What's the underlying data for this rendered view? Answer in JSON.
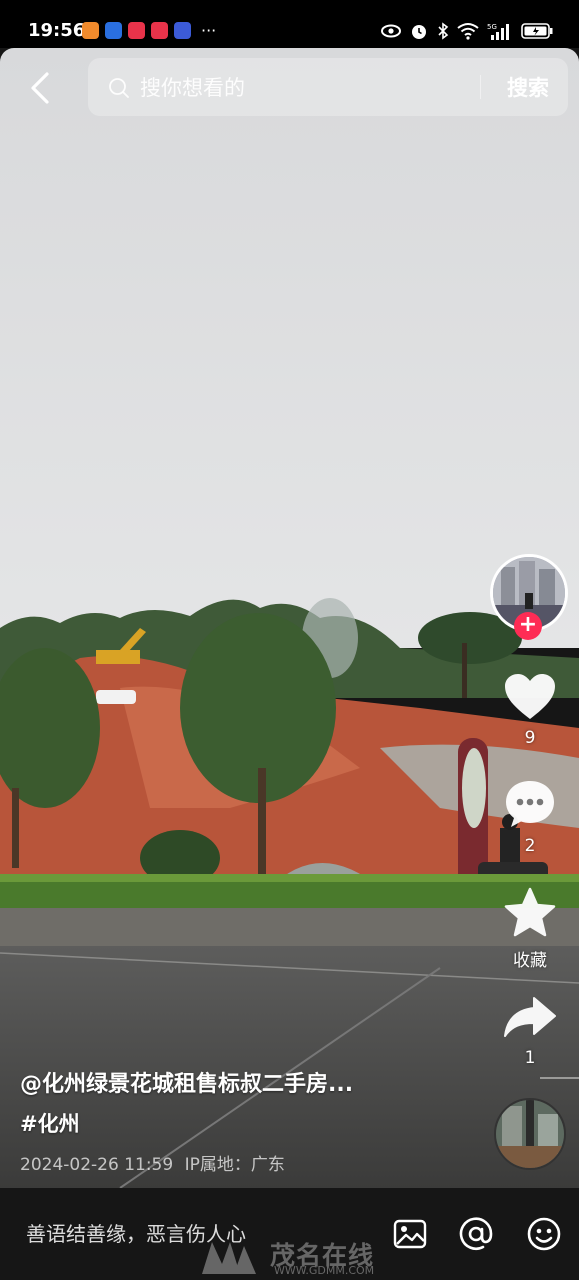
{
  "status_bar": {
    "time": "19:56",
    "more_indicator": "···",
    "app_icons": [
      {
        "name": "app-notification-icon-1",
        "color": "#f08a2c"
      },
      {
        "name": "app-notification-icon-2",
        "color": "#2a6fe0"
      },
      {
        "name": "app-notification-icon-3",
        "color": "#e8334a"
      },
      {
        "name": "app-notification-icon-4",
        "color": "#e8334a"
      },
      {
        "name": "app-notification-icon-5",
        "color": "#3c5bd8"
      }
    ],
    "network": "5G",
    "battery_charging": true
  },
  "search": {
    "placeholder": "搜你想看的",
    "button_label": "搜索"
  },
  "actions": {
    "like_count": "9",
    "comment_count": "2",
    "favorite_label": "收藏",
    "share_count": "1"
  },
  "caption": {
    "author": "@化州绿景花城租售标叔二手房...",
    "hashtag": "#化州",
    "date": "2024-02-26 11:59",
    "ip_location": "IP属地：广东"
  },
  "comment_bar": {
    "placeholder": "善语结善缘，恶言伤人心"
  },
  "watermark": {
    "name": "茂名在线",
    "url": "WWW.GDMM.COM"
  },
  "colors": {
    "accent": "#fe2c55",
    "background": "#161616"
  }
}
